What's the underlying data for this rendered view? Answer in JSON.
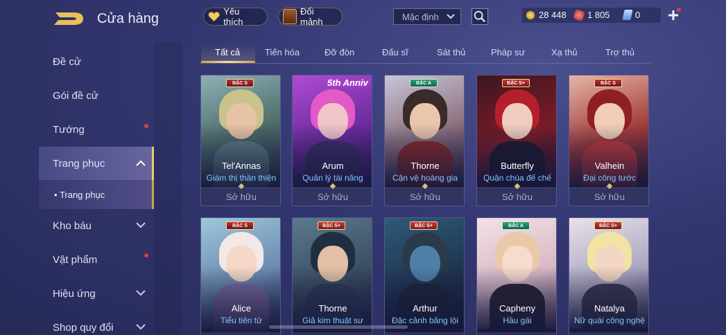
{
  "header": {
    "title": "Cửa hàng",
    "favorite_label": "Yêu thích",
    "exchange_label": "Đổi mảnh",
    "sort_value": "Mặc định",
    "currencies": [
      {
        "icon": "gold-coin-icon",
        "value": "28 448"
      },
      {
        "icon": "ruby-icon",
        "value": "1 805"
      },
      {
        "icon": "voucher-icon",
        "value": "0"
      }
    ]
  },
  "sidebar": {
    "items": [
      {
        "label": "Đề cử"
      },
      {
        "label": "Gói đề cử"
      },
      {
        "label": "Tướng"
      },
      {
        "label": "Trang phục"
      },
      {
        "label": "Kho báu"
      },
      {
        "label": "Vật phẩm"
      },
      {
        "label": "Hiệu ứng"
      },
      {
        "label": "Shop quy đổi"
      }
    ],
    "sub_item": "Trang phục"
  },
  "tabs": [
    "Tất cả",
    "Tiến hóa",
    "Đỡ đòn",
    "Đấu sĩ",
    "Sát thủ",
    "Pháp sư",
    "Xạ thủ",
    "Trợ thủ"
  ],
  "cards": [
    {
      "tier": "BẬC S",
      "hero": "Tel'Annas",
      "skin": "Giám thị thần thiện",
      "status": "Sở hữu"
    },
    {
      "tier": "",
      "banner": "5th Anniv",
      "hero": "Arum",
      "skin": "Quản lý tài năng",
      "status": "Sở hữu"
    },
    {
      "tier": "BẬC A",
      "hero": "Thorne",
      "skin": "Cận vệ hoàng gia",
      "status": "Sở hữu"
    },
    {
      "tier": "BẬC S+",
      "hero": "Butterfly",
      "skin": "Quận chúa đế chế",
      "status": "Sở hữu"
    },
    {
      "tier": "BẬC S",
      "hero": "Valhein",
      "skin": "Đại công tước",
      "status": "Sở hữu"
    },
    {
      "tier": "BẬC S",
      "hero": "Alice",
      "skin": "Tiểu tiên tử",
      "status": ""
    },
    {
      "tier": "BẬC S+",
      "hero": "Thorne",
      "skin": "Giả kim thuật sư",
      "status": ""
    },
    {
      "tier": "BẬC S+",
      "hero": "Arthur",
      "skin": "Đặc cảnh băng lội",
      "status": ""
    },
    {
      "tier": "BẬC A",
      "hero": "Capheny",
      "skin": "Hầu gái",
      "status": ""
    },
    {
      "tier": "BẬC S+",
      "hero": "Natalya",
      "skin": "Nữ quái công nghệ",
      "status": ""
    }
  ]
}
